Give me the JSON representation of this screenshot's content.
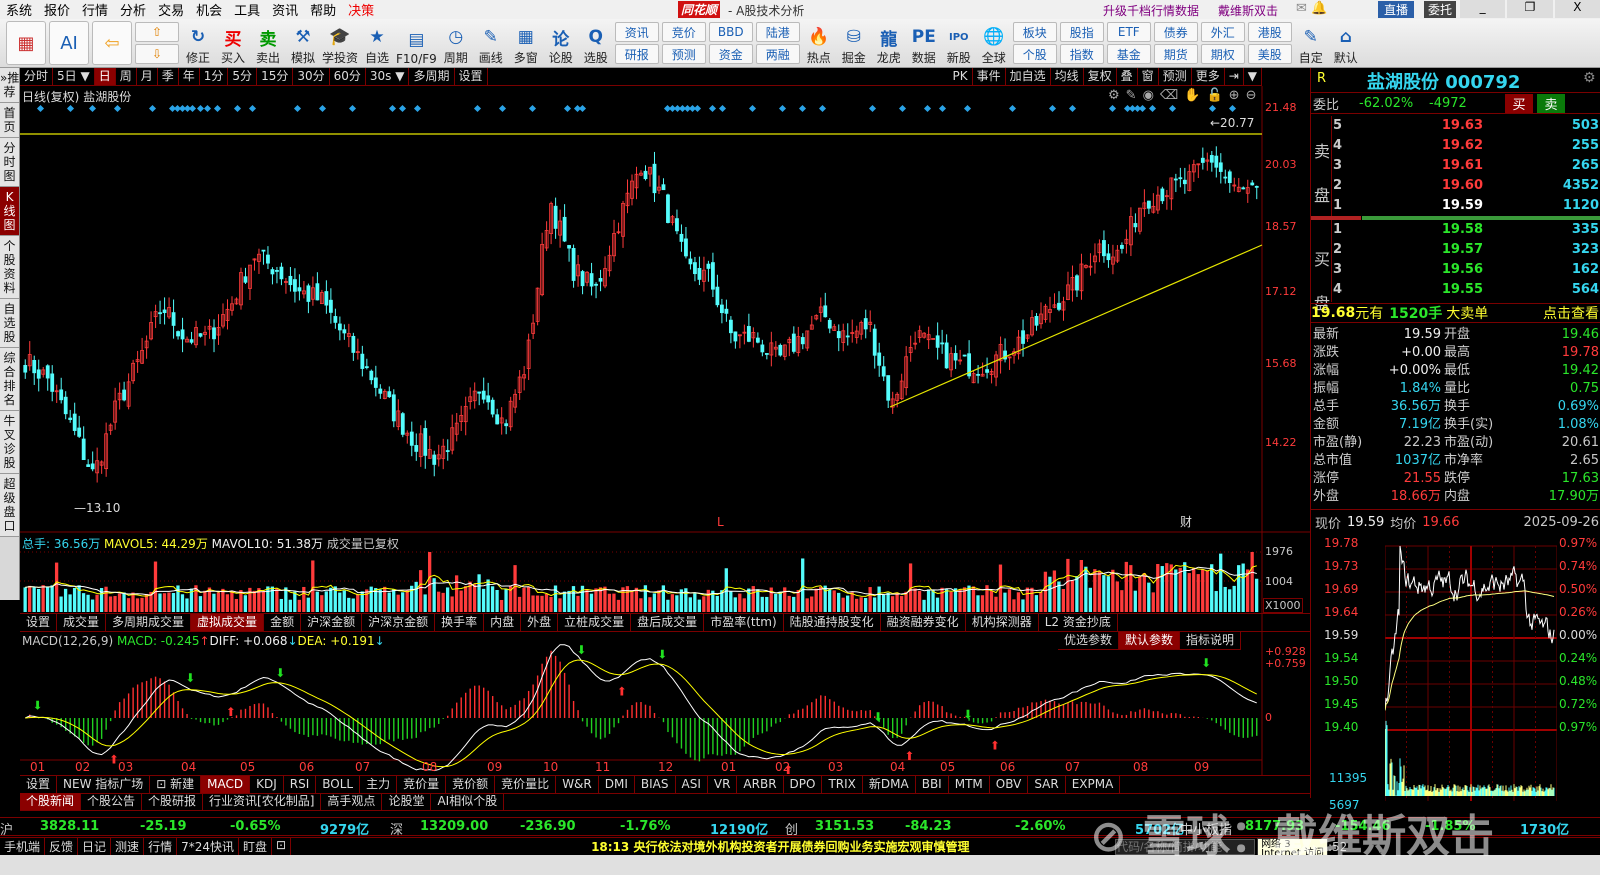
{
  "menu": [
    "系统",
    "报价",
    "行情",
    "分析",
    "交易",
    "机会",
    "工具",
    "资讯",
    "帮助",
    "决策"
  ],
  "app": {
    "logo": "同花顺",
    "title": "- A股技术分析",
    "promo1": "升级千档行情数据",
    "promo2": "戴维斯双击",
    "live": "直播",
    "entrust": "委托"
  },
  "toolbar": {
    "icons1": [
      {
        "label": "",
        "icon": "grid-icon"
      },
      {
        "label": "",
        "icon": "ai-icon"
      },
      {
        "label": "",
        "icon": "back-arrow-icon"
      }
    ],
    "icons2": [
      {
        "label": "修正",
        "glyph": "↻"
      },
      {
        "label": "买入",
        "glyph": "买"
      },
      {
        "label": "卖出",
        "glyph": "卖"
      },
      {
        "label": "模拟",
        "glyph": "⚒"
      },
      {
        "label": "学投资",
        "glyph": "🎓"
      },
      {
        "label": "自选",
        "glyph": "★"
      },
      {
        "label": "F10/F9",
        "glyph": "▤"
      },
      {
        "label": "周期",
        "glyph": "◷"
      },
      {
        "label": "画线",
        "glyph": "✎"
      },
      {
        "label": "多窗",
        "glyph": "▦"
      },
      {
        "label": "论股",
        "glyph": "论"
      },
      {
        "label": "选股",
        "glyph": "Q"
      }
    ],
    "pairs1": [
      [
        "资讯",
        "研报"
      ],
      [
        "竞价",
        "预测"
      ],
      [
        "BBD",
        "资金"
      ],
      [
        "陆港",
        "两融"
      ]
    ],
    "icons3": [
      {
        "label": "热点",
        "glyph": "🔥"
      },
      {
        "label": "掘金",
        "glyph": "⛁"
      },
      {
        "label": "龙虎",
        "glyph": "龍"
      },
      {
        "label": "数据",
        "glyph": "PE"
      },
      {
        "label": "新股",
        "glyph": "IPO"
      },
      {
        "label": "全球",
        "glyph": "🌐"
      }
    ],
    "pairs2": [
      [
        "板块",
        "个股"
      ],
      [
        "股指",
        "指数"
      ],
      [
        "ETF",
        "基金"
      ],
      [
        "债券",
        "期货"
      ],
      [
        "外汇",
        "期权"
      ],
      [
        "港股",
        "美股"
      ]
    ],
    "icons4": [
      {
        "label": "自定",
        "glyph": "✎"
      },
      {
        "label": "默认",
        "glyph": "⌂"
      }
    ]
  },
  "leftnav": [
    "»推荐",
    "首页",
    "分时图",
    "K线图",
    "个股资料",
    "自选股",
    "综合排名",
    "牛叉诊股",
    "超级盘口"
  ],
  "period": {
    "left": [
      "分时",
      "5日 ▼",
      "日",
      "周",
      "月",
      "季",
      "年",
      "1分",
      "5分",
      "15分",
      "30分",
      "60分",
      "30s ▼",
      "多周期",
      "设置"
    ],
    "right": [
      "PK",
      "事件",
      "加自选",
      "均线",
      "复权",
      "叠",
      "窗",
      "预测",
      "更多",
      "⇥",
      "▼"
    ]
  },
  "kline": {
    "title": "日线(复权)",
    "stock": "盐湖股份",
    "price_axis": [
      "21.48",
      "20.03",
      "18.57",
      "17.12",
      "15.68",
      "14.22"
    ],
    "high_label": "20.77",
    "low_label": "13.10",
    "marker_l": "L",
    "marker_cai": "财"
  },
  "chart_data": {
    "type": "candlestick",
    "closes": [
      16.0,
      15.6,
      14.6,
      13.5,
      15.0,
      16.0,
      17.2,
      16.5,
      16.5,
      17.2,
      18.3,
      18.0,
      17.5,
      17.3,
      16.5,
      15.8,
      15.0,
      14.3,
      13.9,
      14.5,
      15.5,
      14.6,
      16.0,
      19.5,
      18.0,
      17.5,
      19.0,
      20.3,
      19.5,
      18.0,
      17.8,
      16.5,
      16.5,
      16.0,
      16.5,
      17.0,
      16.5,
      16.8,
      15.0,
      16.6,
      16.2,
      15.9,
      15.9,
      16.2,
      16.6,
      17.2,
      17.6,
      18.5,
      18.3,
      19.5,
      19.7,
      19.9,
      20.4,
      19.7,
      19.6
    ],
    "ylim": [
      13.1,
      21.48
    ]
  },
  "volume": {
    "total_label": "总手: 36.56万",
    "mavol5": "MAVOL5: 44.29万",
    "mavol10": "MAVOL10: 51.38万",
    "note": "成交量已复权",
    "axis": [
      "1976",
      "1004",
      "X1000"
    ]
  },
  "vol_tabs": [
    "设置",
    "成交量",
    "多周期成交量",
    "虚拟成交量",
    "金额",
    "沪深金额",
    "沪深京金额",
    "换手率",
    "内盘",
    "外盘",
    "立桩成交量",
    "盘后成交量",
    "市盈率(ttm)",
    "陆股通持股变化",
    "融资融券变化",
    "机构探测器",
    "L2 资金抄底"
  ],
  "macd": {
    "name": "MACD(12,26,9)",
    "macd": "MACD: -0.245",
    "diff": "DIFF: +0.068",
    "dea": "DEA: +0.191",
    "axis": [
      "+0.928",
      "+0.759",
      "0"
    ],
    "buttons": [
      "优选参数",
      "默认参数",
      "指标说明"
    ]
  },
  "months": [
    "01",
    "02",
    "03",
    "04",
    "05",
    "06",
    "07",
    "08",
    "09",
    "10",
    "11",
    "12",
    "01",
    "02",
    "03",
    "04",
    "05",
    "06",
    "07",
    "08",
    "09"
  ],
  "ind_tabs": [
    "设置",
    "NEW 指标广场",
    "⊡ 新建",
    "MACD",
    "KDJ",
    "RSI",
    "BOLL",
    "主力",
    "竞价量",
    "竞价额",
    "竞价量比",
    "W&R",
    "DMI",
    "BIAS",
    "ASI",
    "VR",
    "ARBR",
    "DPO",
    "TRIX",
    "新DMA",
    "BBI",
    "MTM",
    "OBV",
    "SAR",
    "EXPMA"
  ],
  "news_tabs": [
    "个股新闻",
    "个股公告",
    "个股研报",
    "行业资讯[农化制品]",
    "高手观点",
    "论股堂",
    "AI相似个股"
  ],
  "right": {
    "r": "R",
    "name": "盐湖股份 000792",
    "weibi_label": "委比",
    "weibi_pct": "-62.02%",
    "weibi_val": "-4972",
    "buy": "买",
    "sell": "卖",
    "sell_label": "卖盘",
    "buy_label": "买盘",
    "asks": [
      [
        "5",
        "19.63",
        "503"
      ],
      [
        "4",
        "19.62",
        "255"
      ],
      [
        "3",
        "19.61",
        "265"
      ],
      [
        "2",
        "19.60",
        "4352"
      ],
      [
        "1",
        "19.59",
        "1120"
      ]
    ],
    "bids": [
      [
        "1",
        "19.58",
        "335"
      ],
      [
        "2",
        "19.57",
        "323"
      ],
      [
        "3",
        "19.56",
        "162"
      ],
      [
        "4",
        "19.55",
        "564"
      ]
    ],
    "big_order": {
      "price": "19.68",
      "t1": "元有",
      "qty": "1520手",
      "t2": "大卖单",
      "link": "点击查看"
    },
    "stats": [
      [
        "最新",
        "19.59",
        "开盘",
        "19.46"
      ],
      [
        "涨跌",
        "+0.00",
        "最高",
        "19.78"
      ],
      [
        "涨幅",
        "+0.00%",
        "最低",
        "19.42"
      ],
      [
        "振幅",
        "1.84%",
        "量比",
        "0.75"
      ],
      [
        "总手",
        "36.56万",
        "换手",
        "0.69%"
      ],
      [
        "金额",
        "7.19亿",
        "换手(实)",
        "1.08%"
      ],
      [
        "市盈(静)",
        "22.23",
        "市盈(动)",
        "20.61"
      ],
      [
        "总市值",
        "1037亿",
        "市净率",
        "2.65"
      ],
      [
        "涨停",
        "21.55",
        "跌停",
        "17.63"
      ],
      [
        "外盘",
        "18.66万",
        "内盘",
        "17.90万"
      ]
    ],
    "intraday": {
      "now_label": "现价",
      "now": "19.59",
      "avg_label": "均价",
      "avg": "19.66",
      "date": "2025-09-26",
      "left_axis": [
        "19.78",
        "19.73",
        "19.69",
        "19.64",
        "19.59",
        "19.54",
        "19.50",
        "19.45",
        "19.40"
      ],
      "right_axis": [
        "0.97%",
        "0.74%",
        "0.50%",
        "0.26%",
        "0.00%",
        "0.24%",
        "0.48%",
        "0.72%",
        "0.97%"
      ],
      "vol_axis": [
        "11395",
        "5697"
      ]
    }
  },
  "indices": [
    {
      "name": "沪",
      "v": "3828.11",
      "c": "-25.19",
      "p": "-0.65%",
      "a": "9279亿"
    },
    {
      "name": "深",
      "v": "13209.00",
      "c": "-236.90",
      "p": "-1.76%",
      "a": "12190亿"
    },
    {
      "name": "创",
      "v": "3151.53",
      "c": "-84.23",
      "p": "-2.60%",
      "a": "5702亿"
    },
    {
      "name": "中小板指",
      "v": "8177.93",
      "c": "-154.46",
      "p": "-1.85%",
      "a": "1730亿"
    }
  ],
  "status": {
    "items": [
      "手机端",
      "反馈",
      "日记",
      "测速",
      "行情",
      "7*24快讯",
      "盯盘",
      "⊡"
    ],
    "ticker": "18:13 央行依法对境外机构投资者开展债券回购业务实施宏观审慎管理",
    "search_placeholder": "代码/名称/简拼/功能",
    "net": "网络 3",
    "net2": "Internet 访问",
    "time": ":52"
  },
  "watermark": "雪球：戴维斯双击",
  "colors": {
    "up": "#ff3b3b",
    "down": "#54fcfc",
    "grid": "#7a0000",
    "diff": "#ffffff",
    "dea": "#ffff00"
  }
}
